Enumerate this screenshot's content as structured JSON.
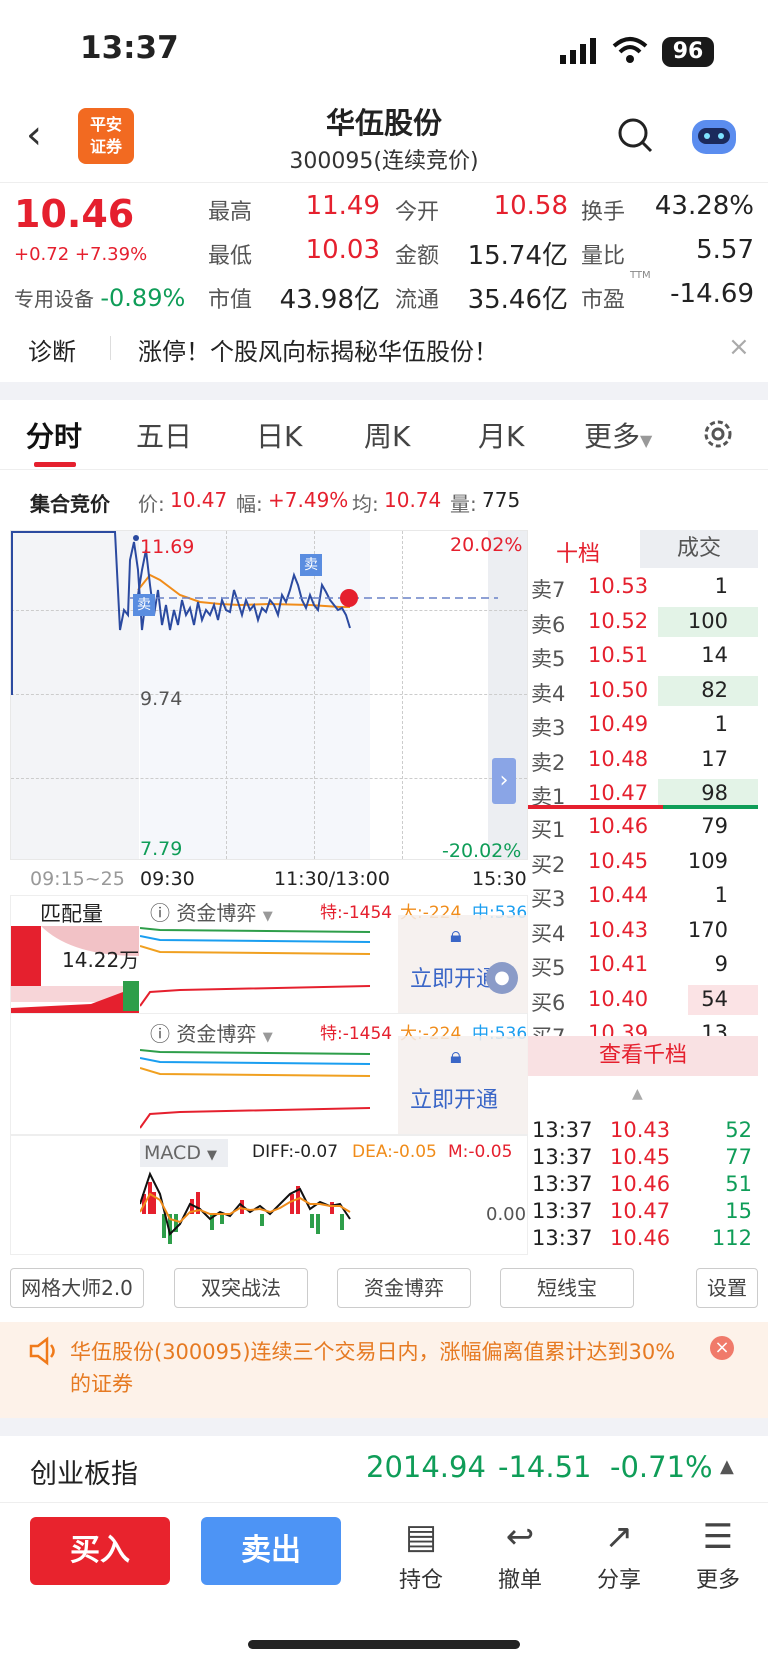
{
  "status": {
    "time": "13:37",
    "battery": "96"
  },
  "header": {
    "logo_line1": "平安",
    "logo_line2": "证券",
    "title": "华伍股份",
    "subtitle": "300095(连续竞价)"
  },
  "quote": {
    "price": "10.46",
    "change": "+0.72",
    "change_pct": "+7.39%",
    "sector_name": "专用设备",
    "sector_change": "-0.89%",
    "fields": [
      {
        "label": "最高",
        "value": "11.49"
      },
      {
        "label": "今开",
        "value": "10.58"
      },
      {
        "label": "换手",
        "value": "43.28%"
      },
      {
        "label": "最低",
        "value": "10.03"
      },
      {
        "label": "金额",
        "value": "15.74亿"
      },
      {
        "label": "量比",
        "value": "5.57"
      },
      {
        "label": "市值",
        "value": "43.98亿"
      },
      {
        "label": "流通",
        "value": "35.46亿"
      },
      {
        "label": "市盈",
        "value": "-14.69"
      }
    ],
    "ttm": "TTM"
  },
  "diagnosis": {
    "label": "诊断",
    "text": "涨停！个股风向标揭秘华伍股份！"
  },
  "tabs": [
    "分时",
    "五日",
    "日K",
    "周K",
    "月K",
    "更多"
  ],
  "auction": {
    "title": "集合竞价",
    "price_label": "价:",
    "price": "10.47",
    "range_label": "幅:",
    "range": "+7.49%",
    "avg_label": "均:",
    "avg": "10.74",
    "vol_label": "量:",
    "vol": "775"
  },
  "chart": {
    "y_top": "11.69",
    "y_mid": "9.74",
    "y_bottom": "7.79",
    "pct_top": "20.02%",
    "pct_bottom": "-20.02%",
    "time_pre": "09:15~25",
    "time_open": "09:30",
    "time_mid": "11:30/13:00",
    "time_close": "15:30",
    "sell_tag": "卖",
    "match_label": "匹配量",
    "match_value": "14.22万"
  },
  "orderbook": {
    "tab_active": "十档",
    "tab_other": "成交",
    "rows": [
      {
        "label": "卖7",
        "price": "10.53",
        "vol": "1"
      },
      {
        "label": "卖6",
        "price": "10.52",
        "vol": "100"
      },
      {
        "label": "卖5",
        "price": "10.51",
        "vol": "14"
      },
      {
        "label": "卖4",
        "price": "10.50",
        "vol": "82"
      },
      {
        "label": "卖3",
        "price": "10.49",
        "vol": "1"
      },
      {
        "label": "卖2",
        "price": "10.48",
        "vol": "17"
      },
      {
        "label": "卖1",
        "price": "10.47",
        "vol": "98"
      },
      {
        "label": "买1",
        "price": "10.46",
        "vol": "79"
      },
      {
        "label": "买2",
        "price": "10.45",
        "vol": "109"
      },
      {
        "label": "买3",
        "price": "10.44",
        "vol": "1"
      },
      {
        "label": "买4",
        "price": "10.43",
        "vol": "170"
      },
      {
        "label": "买5",
        "price": "10.41",
        "vol": "9"
      },
      {
        "label": "买6",
        "price": "10.40",
        "vol": "54"
      },
      {
        "label": "买7",
        "price": "10.39",
        "vol": "13"
      }
    ],
    "view_all": "查看千档",
    "trades": [
      {
        "time": "13:37",
        "price": "10.43",
        "vol": "52"
      },
      {
        "time": "13:37",
        "price": "10.45",
        "vol": "77"
      },
      {
        "time": "13:37",
        "price": "10.46",
        "vol": "51"
      },
      {
        "time": "13:37",
        "price": "10.47",
        "vol": "15"
      },
      {
        "time": "13:37",
        "price": "10.46",
        "vol": "112"
      }
    ]
  },
  "fund_panel": {
    "title": "资金博弈",
    "te": "特:-1454",
    "da": "大:-224",
    "zhong": "中:536",
    "unlock": "立即开通"
  },
  "macd": {
    "title": "MACD",
    "diff": "DIFF:-0.07",
    "dea": "DEA:-0.05",
    "m": "M:-0.05",
    "zero": "0.00"
  },
  "tools": [
    "网格大师2.0",
    "双突战法",
    "资金博弈",
    "短线宝",
    "设置"
  ],
  "notice": {
    "text": "华伍股份(300095)连续三个交易日内，涨幅偏离值累计达到30%的证券"
  },
  "index": {
    "name": "创业板指",
    "value": "2014.94",
    "change": "-14.51",
    "pct": "-0.71%"
  },
  "footer": {
    "buy": "买入",
    "sell": "卖出",
    "hold": "持仓",
    "cancel": "撤单",
    "share": "分享",
    "more": "更多"
  },
  "colors": {
    "up": "#e5202e",
    "down": "#0f9d58",
    "buy_btn": "#e8232d",
    "sell_btn": "#4d94f5"
  }
}
